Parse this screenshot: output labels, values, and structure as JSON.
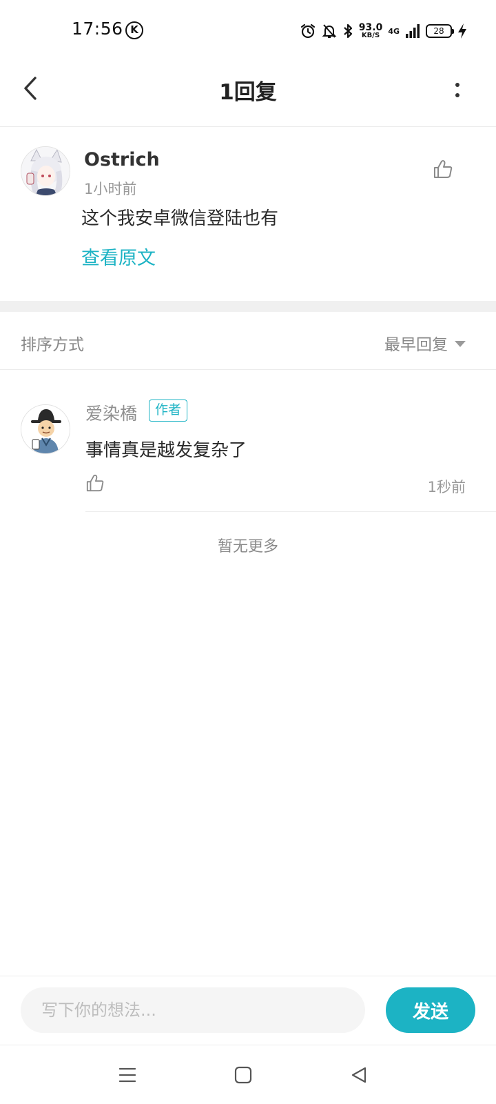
{
  "status_bar": {
    "time": "17:56",
    "k_badge": "K",
    "speed_value": "93.0",
    "speed_unit": "KB/S",
    "network": "4G",
    "battery": "28"
  },
  "header": {
    "title": "1回复"
  },
  "main_comment": {
    "username": "Ostrich",
    "time": "1小时前",
    "content": "这个我安卓微信登陆也有",
    "view_original": "查看原文"
  },
  "sort": {
    "label": "排序方式",
    "selected": "最早回复"
  },
  "replies": [
    {
      "username": "爱染橋",
      "badge": "作者",
      "content": "事情真是越发复杂了",
      "time": "1秒前"
    }
  ],
  "no_more": "暂无更多",
  "input": {
    "placeholder": "写下你的想法...",
    "send_label": "发送"
  },
  "colors": {
    "accent": "#1cb3c4",
    "muted_text": "#8f8f8f",
    "divider": "#f0f0f0"
  }
}
